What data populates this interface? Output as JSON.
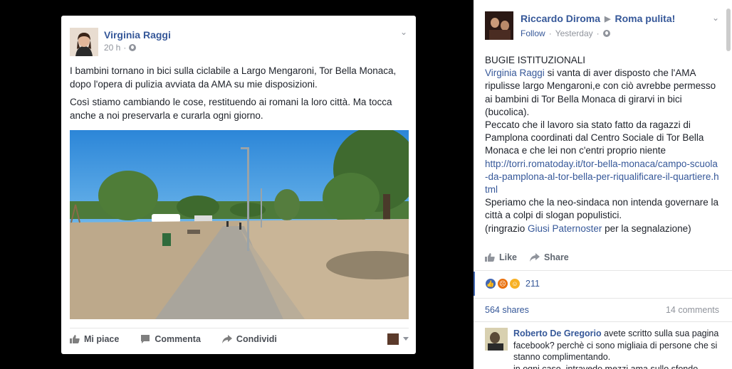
{
  "post": {
    "author": "Virginia Raggi",
    "time": "20 h",
    "paragraph1": "I bambini tornano in bici sulla ciclabile a Largo Mengaroni, Tor Bella Monaca, dopo l'opera di pulizia avviata da AMA su mie disposizioni.",
    "paragraph2": "Così stiamo cambiando le cose, restituendo ai romani la loro città. Ma tocca anche a noi preservarla e curarla ogni giorno.",
    "actions": {
      "like": "Mi piace",
      "comment": "Commenta",
      "share": "Condividi"
    }
  },
  "panel": {
    "author": "Riccardo Diroma",
    "group": "Roma pulita!",
    "follow": "Follow",
    "time": "Yesterday",
    "title": "BUGIE ISTITUZIONALI",
    "mention1": "Virginia Raggi",
    "text1": " si vanta di aver disposto che l'AMA ripulisse largo Mengaroni,e con ciò avrebbe permesso ai bambini di Tor Bella Monaca di girarvi in bici (bucolica).",
    "text2": "Peccato che il lavoro sia stato fatto da ragazzi di Pamplona coordinati dal Centro Sociale di Tor Bella Monaca e che lei non c'entri proprio niente",
    "link": "http://torri.romatoday.it/tor-bella-monaca/campo-scuola-da-pamplona-al-tor-bella-per-riqualificare-il-quartiere.html",
    "text3": "Speriamo che la neo-sindaca non intenda governare la città a colpi di slogan populistici.",
    "thanks_pre": "(ringrazio ",
    "mention2": "Giusi Paternoster",
    "thanks_post": " per la segnalazione)",
    "like": "Like",
    "share": "Share",
    "reaction_count": "211",
    "shares": "564 shares",
    "comments": "14 comments",
    "comment": {
      "name": "Roberto De Gregorio",
      "text": " avete scritto sulla sua pagina facebook? perchè ci sono migliaia di persone che si stanno complimentando.",
      "text2": "in ogni caso, intravedo mezzi ama sullo sfondo"
    }
  },
  "colors": {
    "link": "#365899",
    "sky": "#3a8fd6",
    "grass": "#c7b595"
  }
}
